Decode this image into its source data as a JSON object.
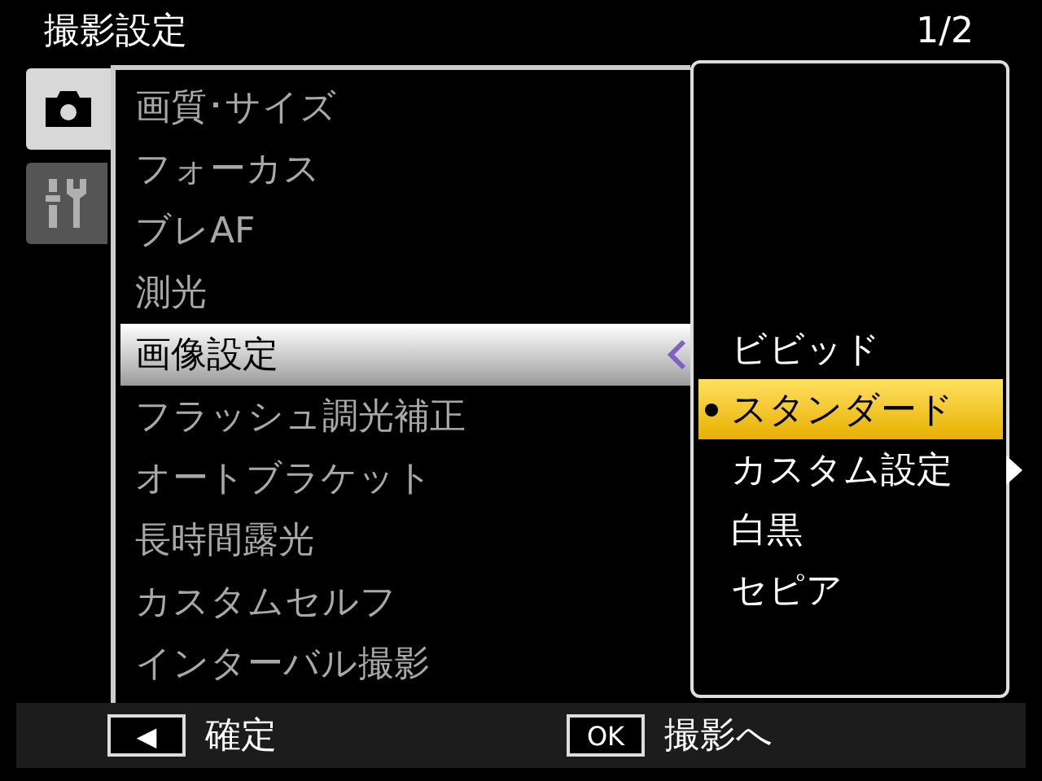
{
  "header": {
    "title": "撮影設定",
    "page": "1/2"
  },
  "tabs": [
    {
      "kind": "camera",
      "selected": true
    },
    {
      "kind": "tools",
      "selected": false
    }
  ],
  "menu": {
    "items": [
      {
        "label": "画質･サイズ",
        "selected": false
      },
      {
        "label": "フォーカス",
        "selected": false
      },
      {
        "label": "ブレAF",
        "selected": false
      },
      {
        "label": "測光",
        "selected": false
      },
      {
        "label": "画像設定",
        "selected": true
      },
      {
        "label": "フラッシュ調光補正",
        "selected": false
      },
      {
        "label": "オートブラケット",
        "selected": false
      },
      {
        "label": "長時間露光",
        "selected": false
      },
      {
        "label": "カスタムセルフ",
        "selected": false
      },
      {
        "label": "インターバル撮影",
        "selected": false
      }
    ]
  },
  "submenu": {
    "items": [
      {
        "label": "ビビッド",
        "selected": false,
        "current": false,
        "has_submenu": false
      },
      {
        "label": "スタンダード",
        "selected": true,
        "current": true,
        "has_submenu": false
      },
      {
        "label": "カスタム設定",
        "selected": false,
        "current": false,
        "has_submenu": true
      },
      {
        "label": "白黒",
        "selected": false,
        "current": false,
        "has_submenu": false
      },
      {
        "label": "セピア",
        "selected": false,
        "current": false,
        "has_submenu": false
      }
    ]
  },
  "footer": {
    "hints": [
      {
        "key": "◀",
        "label": "確定"
      },
      {
        "key": "OK",
        "label": "撮影へ"
      }
    ]
  }
}
